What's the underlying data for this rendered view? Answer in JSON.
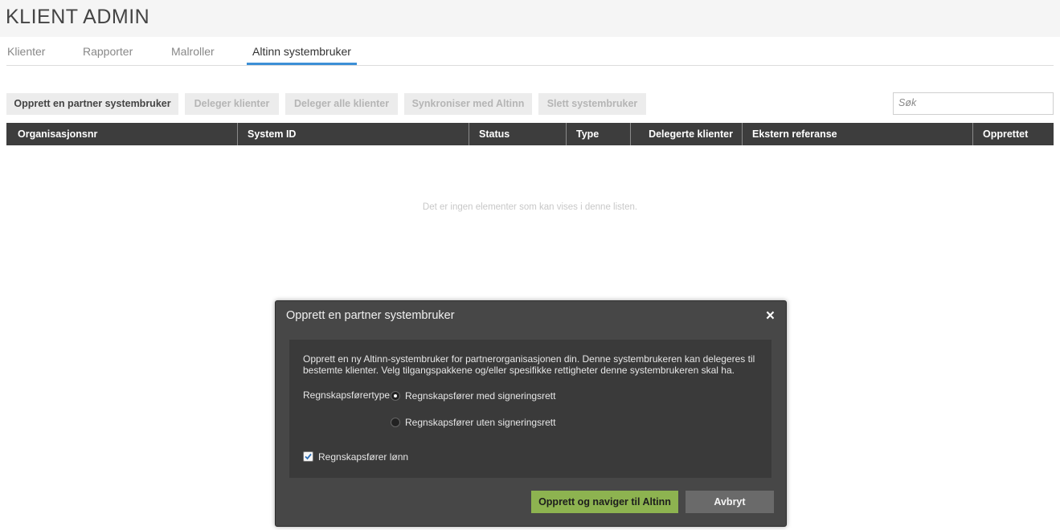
{
  "app": {
    "title": "KLIENT ADMIN"
  },
  "tabs": [
    {
      "label": "Klienter"
    },
    {
      "label": "Rapporter"
    },
    {
      "label": "Malroller"
    },
    {
      "label": "Altinn systembruker"
    }
  ],
  "toolbar": {
    "create_partner": "Opprett en partner systembruker",
    "delegate_clients": "Deleger klienter",
    "delegate_all": "Deleger alle klienter",
    "sync_altinn": "Synkroniser med Altinn",
    "delete_systemuser": "Slett systembruker",
    "search_placeholder": "Søk"
  },
  "table": {
    "columns": [
      "Organisasjonsnr",
      "System ID",
      "Status",
      "Type",
      "Delegerte klienter",
      "Ekstern referanse",
      "Opprettet"
    ],
    "empty_message": "Det er ingen elementer som kan vises i denne listen."
  },
  "modal": {
    "title": "Opprett en partner systembruker",
    "close_symbol": "×",
    "description": "Opprett en ny Altinn-systembruker for partnerorganisasjonen din. Denne systembrukeren kan delegeres til bestemte klienter. Velg tilgangspakkene og/eller spesifikke rettigheter denne systembrukeren skal ha.",
    "field_label": "Regnskapsførertype",
    "radio_options": [
      {
        "label": "Regnskapsfører med signeringsrett",
        "checked": true
      },
      {
        "label": "Regnskapsfører uten signeringsrett",
        "checked": false
      }
    ],
    "checkbox": {
      "label": "Regnskapsfører lønn",
      "checked": true
    },
    "primary_button": "Opprett og naviger til Altinn",
    "cancel_button": "Avbryt"
  },
  "colors": {
    "active_tab": "#3c8fd6",
    "table_header": "#3d3d3d",
    "modal_bg": "#474747",
    "primary_button": "#8db350"
  }
}
